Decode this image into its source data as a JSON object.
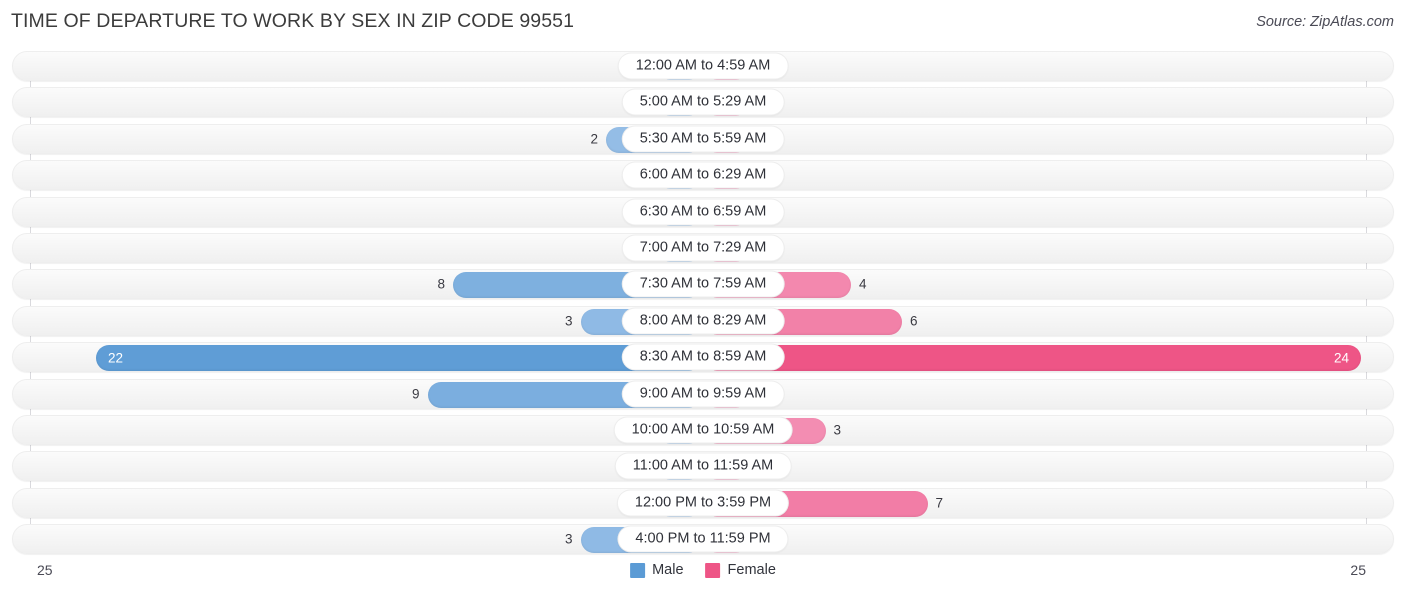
{
  "header": {
    "title": "TIME OF DEPARTURE TO WORK BY SEX IN ZIP CODE 99551",
    "source": "Source: ZipAtlas.com"
  },
  "footer": {
    "axis_left": "25",
    "axis_right": "25",
    "legend": [
      {
        "label": "Male",
        "color": "#5B9BD5"
      },
      {
        "label": "Female",
        "color": "#EE5586"
      }
    ]
  },
  "colors": {
    "male_min": "#A8C9EC",
    "male_max": "#5B9BD5",
    "female_min": "#F6A7C6",
    "female_max": "#EE5586",
    "track": "#F5F5F5",
    "axis": "#D9D9DD"
  },
  "chart_data": {
    "type": "bar",
    "title": "TIME OF DEPARTURE TO WORK BY SEX IN ZIP CODE 99551",
    "subtitle": "Source: ZipAtlas.com",
    "orientation": "horizontal-diverging",
    "xlabel": "",
    "ylabel": "",
    "xlim": [
      25,
      25
    ],
    "axis_ticks": [
      "25",
      "25"
    ],
    "grid": false,
    "legend_position": "bottom-center",
    "categories": [
      "12:00 AM to 4:59 AM",
      "5:00 AM to 5:29 AM",
      "5:30 AM to 5:59 AM",
      "6:00 AM to 6:29 AM",
      "6:30 AM to 6:59 AM",
      "7:00 AM to 7:29 AM",
      "7:30 AM to 7:59 AM",
      "8:00 AM to 8:29 AM",
      "8:30 AM to 8:59 AM",
      "9:00 AM to 9:59 AM",
      "10:00 AM to 10:59 AM",
      "11:00 AM to 11:59 AM",
      "12:00 PM to 3:59 PM",
      "4:00 PM to 11:59 PM"
    ],
    "series": [
      {
        "name": "Male",
        "color": "#5B9BD5",
        "values": [
          0,
          0,
          2,
          0,
          0,
          0,
          8,
          3,
          22,
          9,
          0,
          0,
          0,
          3
        ]
      },
      {
        "name": "Female",
        "color": "#EE5586",
        "values": [
          0,
          0,
          0,
          0,
          0,
          0,
          4,
          6,
          24,
          0,
          3,
          0,
          7,
          0
        ]
      }
    ]
  }
}
